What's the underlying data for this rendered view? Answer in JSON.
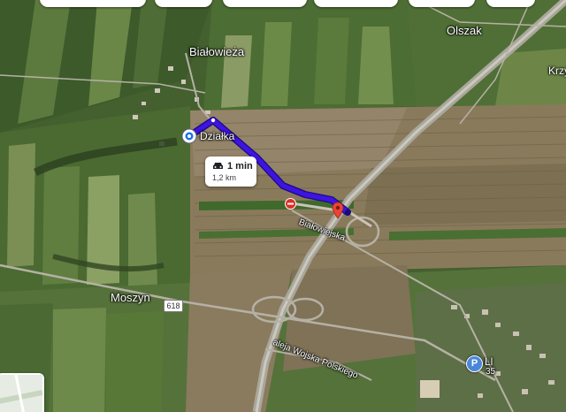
{
  "places": {
    "bialowieza": "Białowieża",
    "olszak": "Olszak",
    "krzy": "Krzy",
    "moszyn": "Moszyn",
    "dzialka": "Działka"
  },
  "roads": {
    "bialowiejska": "Białowiejska",
    "aleja": "aleja Wojska Polskiego",
    "route_number": "618"
  },
  "route": {
    "time": "1 min",
    "distance": "1,2 km",
    "color": "#3d14e0"
  },
  "parking": {
    "icon": "P",
    "label": "Ll",
    "sublabel": "35"
  },
  "icons": {
    "origin": "origin-circle-icon",
    "destination": "red-pin-icon",
    "no_entry": "no-entry-icon",
    "car": "car-icon",
    "parking": "parking-icon"
  }
}
